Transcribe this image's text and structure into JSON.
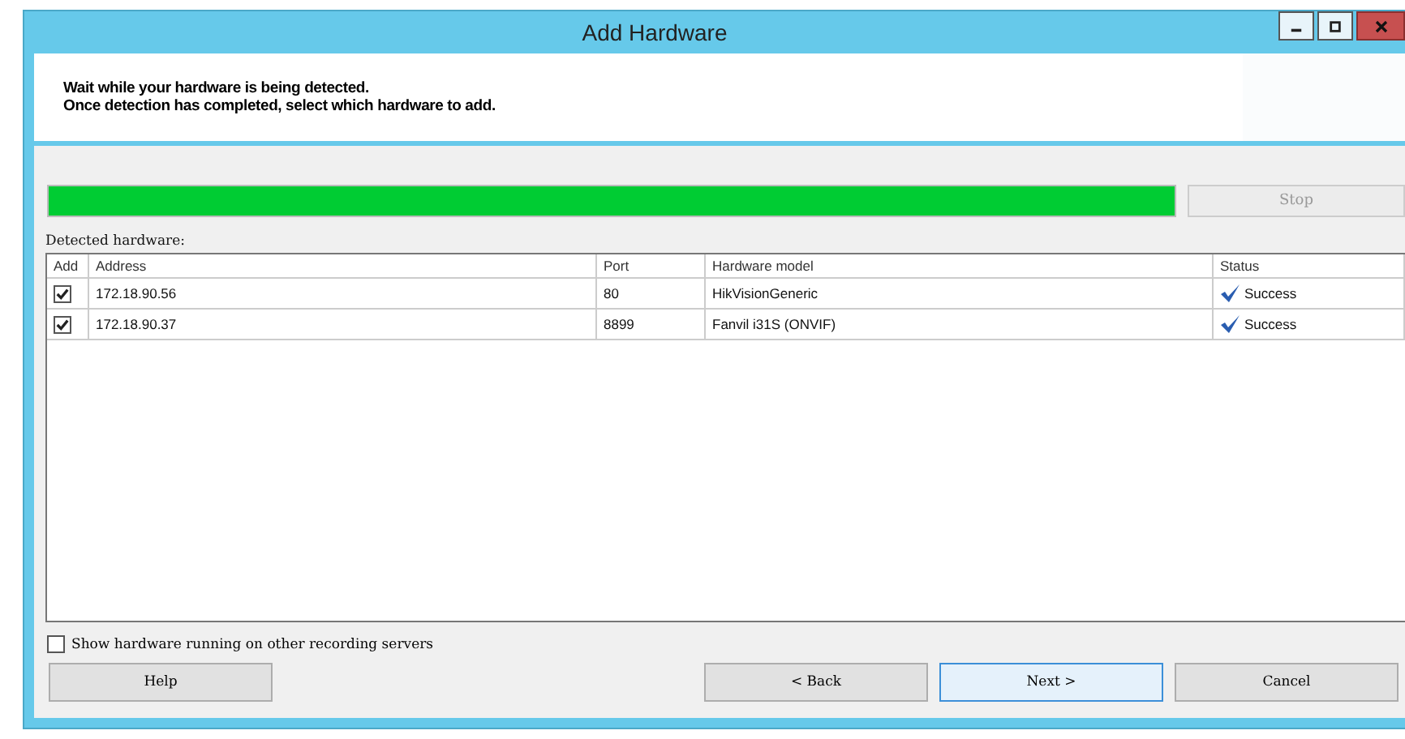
{
  "window": {
    "title": "Add Hardware"
  },
  "instructions": [
    "Wait while your hardware is being detected.",
    "Once detection has completed, select which hardware to add."
  ],
  "progress": {
    "level": 1
  },
  "stop_button": {
    "label": "Stop",
    "disabled": true
  },
  "table": {
    "caption": "Detected hardware:",
    "columns": [
      "Add",
      "Address",
      "Port",
      "Hardware model",
      "Status"
    ],
    "rows": [
      {
        "checked": true,
        "address": "172.18.90.56",
        "port": "80",
        "model": "HikVisionGeneric",
        "status": "Success"
      },
      {
        "checked": true,
        "address": "172.18.90.37",
        "port": "8899",
        "model": "Fanvil i31S (ONVIF)",
        "status": "Success"
      }
    ]
  },
  "show_other": {
    "label": "Show hardware running on other recording servers",
    "checked": false
  },
  "buttons": [
    {
      "label": "Help",
      "focused": false
    },
    {
      "label": "< Back",
      "focused": false
    },
    {
      "label": "Next >",
      "focused": true
    },
    {
      "label": "Cancel",
      "focused": false
    }
  ]
}
